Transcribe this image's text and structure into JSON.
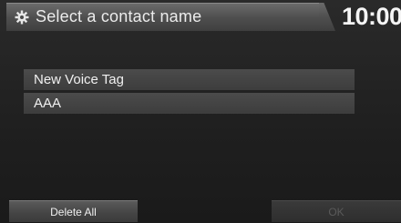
{
  "header": {
    "title": "Select a contact name",
    "icon": "settings-icon",
    "clock": "10:00"
  },
  "contacts": {
    "items": [
      {
        "label": "New Voice Tag"
      },
      {
        "label": "AAA"
      }
    ]
  },
  "footer": {
    "delete_all_label": "Delete All",
    "ok_label": "OK"
  },
  "colors": {
    "header_bar": "#555555",
    "list_item": "#444444",
    "ok_disabled_text": "#5a5a5a"
  }
}
